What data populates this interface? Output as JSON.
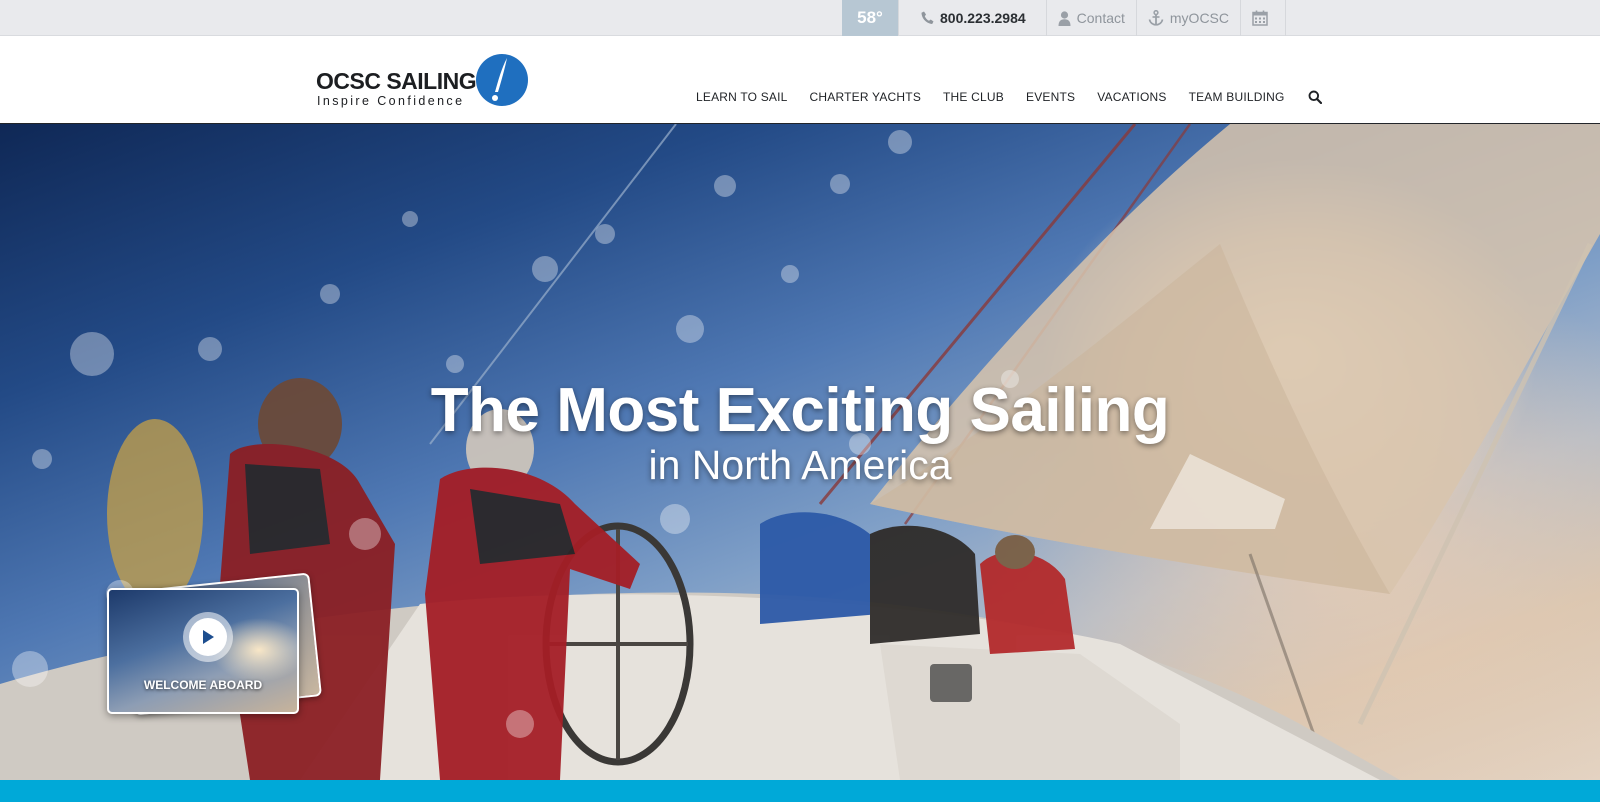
{
  "utility_bar": {
    "temperature": "58°",
    "phone": "800.223.2984",
    "contact_label": "Contact",
    "account_label": "myOCSC",
    "icons": [
      "phone-icon",
      "user-icon",
      "anchor-icon",
      "calendar-icon"
    ]
  },
  "header": {
    "logo": {
      "wordmark": "OCSC SAILING",
      "tagline": "Inspire Confidence"
    },
    "nav": {
      "items": [
        {
          "label": "LEARN TO SAIL"
        },
        {
          "label": "CHARTER YACHTS"
        },
        {
          "label": "THE CLUB"
        },
        {
          "label": "EVENTS"
        },
        {
          "label": "VACATIONS"
        },
        {
          "label": "TEAM BUILDING"
        }
      ],
      "search_icon": "search-icon"
    }
  },
  "hero": {
    "title": "The Most Exciting Sailing",
    "subtitle": "in North America",
    "video": {
      "label": "WELCOME ABOARD",
      "icon": "play-icon"
    }
  },
  "colors": {
    "utility_bg": "#e9eaed",
    "temperature_bg": "#b7c7d3",
    "logo_blue": "#1f6fbf",
    "accent_strip": "#00a9d8",
    "text_dark": "#1f2226"
  }
}
